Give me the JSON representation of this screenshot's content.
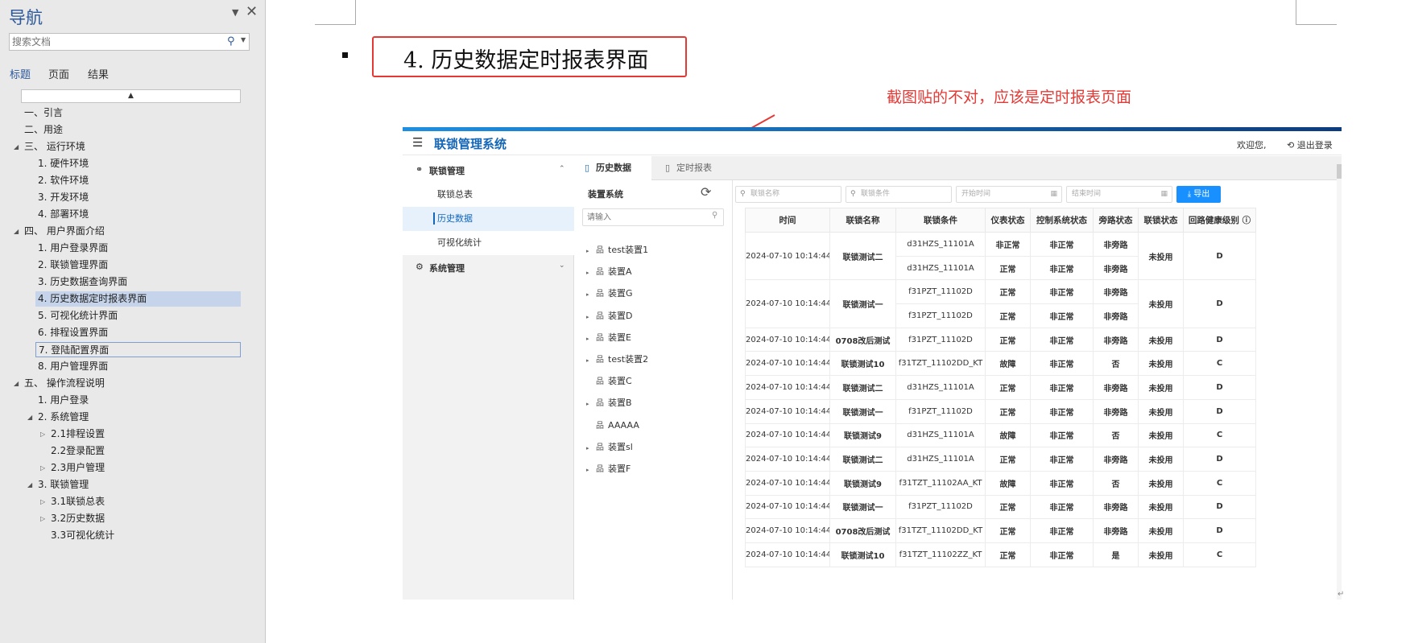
{
  "nav": {
    "title": "导航",
    "search_placeholder": "搜索文档",
    "tabs": [
      "标题",
      "页面",
      "结果"
    ],
    "collapse_glyph": "▲",
    "items": [
      "一、引言",
      "二、用途",
      "三、 运行环境",
      "1. 硬件环境",
      "2. 软件环境",
      "3. 开发环境",
      "4. 部署环境",
      "四、 用户界面介绍",
      "1. 用户登录界面",
      "2. 联锁管理界面",
      "3. 历史数据查询界面",
      "4. 历史数据定时报表界面",
      "5. 可视化统计界面",
      "6. 排程设置界面",
      "7. 登陆配置界面",
      "8. 用户管理界面",
      "五、 操作流程说明",
      "1. 用户登录",
      "2. 系统管理",
      "2.1排程设置",
      "2.2登录配置",
      "2.3用户管理",
      "3. 联锁管理",
      "3.1联锁总表",
      "3.2历史数据",
      "3.3可视化统计"
    ]
  },
  "doc": {
    "heading": "4. 历史数据定时报表界面",
    "annotation": "截图贴的不对，应该是定时报表页面"
  },
  "app": {
    "title": "联锁管理系统",
    "welcome": "欢迎您,",
    "logout": "退出登录",
    "sidebar": {
      "group1": "联锁管理",
      "sub": [
        "联锁总表",
        "历史数据",
        "可视化统计"
      ],
      "group2": "系统管理"
    },
    "tabs": [
      "历史数据",
      "定时报表"
    ],
    "tree": {
      "title": "装置系统",
      "search_placeholder": "请输入",
      "nodes": [
        "test装置1",
        "装置A",
        "装置G",
        "装置D",
        "装置E",
        "test装置2",
        "装置C",
        "装置B",
        "AAAAA",
        "装置sl",
        "装置F"
      ]
    },
    "filters": {
      "name": "联锁名称",
      "condition": "联锁条件",
      "start": "开始时间",
      "end": "结束时间",
      "export": "导出"
    },
    "table": {
      "headers": [
        "时间",
        "联锁名称",
        "联锁条件",
        "仪表状态",
        "控制系统状态",
        "旁路状态",
        "联锁状态",
        "回路健康级别"
      ],
      "rows": [
        {
          "time": "2024-07-10 10:14:44",
          "name": "联锁测试二",
          "lines": [
            [
              "d31HZS_11101A",
              "非正常",
              "非正常",
              "非旁路"
            ],
            [
              "d31HZS_11101A",
              "正常",
              "非正常",
              "非旁路"
            ]
          ],
          "lock": "未投用",
          "level": "D"
        },
        {
          "time": "2024-07-10 10:14:44",
          "name": "联锁测试一",
          "lines": [
            [
              "f31PZT_11102D",
              "正常",
              "非正常",
              "非旁路"
            ],
            [
              "f31PZT_11102D",
              "正常",
              "非正常",
              "非旁路"
            ]
          ],
          "lock": "未投用",
          "level": "D"
        },
        {
          "time": "2024-07-10 10:14:44",
          "name": "0708改后测试",
          "lines": [
            [
              "f31PZT_11102D",
              "正常",
              "非正常",
              "非旁路"
            ]
          ],
          "lock": "未投用",
          "level": "D"
        },
        {
          "time": "2024-07-10 10:14:44",
          "name": "联锁测试10",
          "lines": [
            [
              "f31TZT_11102DD_KT",
              "故障",
              "非正常",
              "否"
            ]
          ],
          "lock": "未投用",
          "level": "C"
        },
        {
          "time": "2024-07-10 10:14:44",
          "name": "联锁测试二",
          "lines": [
            [
              "d31HZS_11101A",
              "正常",
              "非正常",
              "非旁路"
            ]
          ],
          "lock": "未投用",
          "level": "D"
        },
        {
          "time": "2024-07-10 10:14:44",
          "name": "联锁测试一",
          "lines": [
            [
              "f31PZT_11102D",
              "正常",
              "非正常",
              "非旁路"
            ]
          ],
          "lock": "未投用",
          "level": "D"
        },
        {
          "time": "2024-07-10 10:14:44",
          "name": "联锁测试9",
          "lines": [
            [
              "d31HZS_11101A",
              "故障",
              "非正常",
              "否"
            ]
          ],
          "lock": "未投用",
          "level": "C"
        },
        {
          "time": "2024-07-10 10:14:44",
          "name": "联锁测试二",
          "lines": [
            [
              "d31HZS_11101A",
              "正常",
              "非正常",
              "非旁路"
            ]
          ],
          "lock": "未投用",
          "level": "D"
        },
        {
          "time": "2024-07-10 10:14:44",
          "name": "联锁测试9",
          "lines": [
            [
              "f31TZT_11102AA_KT",
              "故障",
              "非正常",
              "否"
            ]
          ],
          "lock": "未投用",
          "level": "C"
        },
        {
          "time": "2024-07-10 10:14:44",
          "name": "联锁测试一",
          "lines": [
            [
              "f31PZT_11102D",
              "正常",
              "非正常",
              "非旁路"
            ]
          ],
          "lock": "未投用",
          "level": "D"
        },
        {
          "time": "2024-07-10 10:14:44",
          "name": "0708改后测试",
          "lines": [
            [
              "f31TZT_11102DD_KT",
              "正常",
              "非正常",
              "非旁路"
            ]
          ],
          "lock": "未投用",
          "level": "D"
        },
        {
          "time": "2024-07-10 10:14:44",
          "name": "联锁测试10",
          "lines": [
            [
              "f31TZT_11102ZZ_KT",
              "正常",
              "非正常",
              "是"
            ]
          ],
          "lock": "未投用",
          "level": "C"
        }
      ]
    }
  },
  "colors": {
    "accent": "#1466b8",
    "highlight_red": "#e53935",
    "nav_selected": "#c5d4ea"
  }
}
